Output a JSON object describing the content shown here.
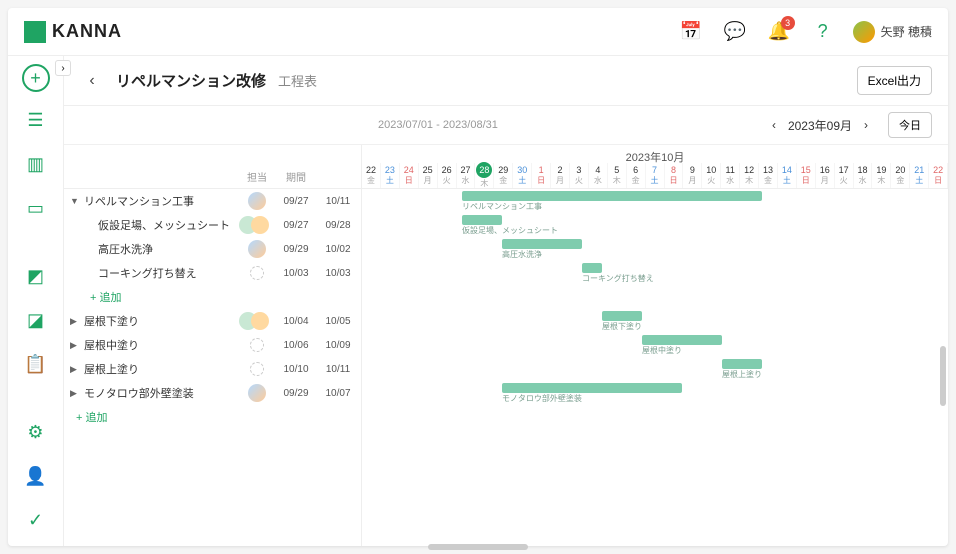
{
  "app": {
    "name": "KANNA"
  },
  "topbar": {
    "badge": "3",
    "user_name": "矢野 穂積"
  },
  "header": {
    "title": "リペルマンション改修",
    "subtitle": "工程表",
    "excel_btn": "Excel出力"
  },
  "subheader": {
    "date_range": "2023/07/01 - 2023/08/31",
    "month_label": "2023年09月",
    "today_btn": "今日"
  },
  "cols": {
    "assignee": "担当",
    "period": "期間"
  },
  "month_header": "2023年10月",
  "days": [
    {
      "n": "22",
      "w": "金"
    },
    {
      "n": "23",
      "w": "土",
      "cls": "sat"
    },
    {
      "n": "24",
      "w": "日",
      "cls": "sun"
    },
    {
      "n": "25",
      "w": "月"
    },
    {
      "n": "26",
      "w": "火"
    },
    {
      "n": "27",
      "w": "水"
    },
    {
      "n": "28",
      "w": "木",
      "cls": "today"
    },
    {
      "n": "29",
      "w": "金"
    },
    {
      "n": "30",
      "w": "土",
      "cls": "sat"
    },
    {
      "n": "1",
      "w": "日",
      "cls": "sun"
    },
    {
      "n": "2",
      "w": "月"
    },
    {
      "n": "3",
      "w": "火"
    },
    {
      "n": "4",
      "w": "水"
    },
    {
      "n": "5",
      "w": "木"
    },
    {
      "n": "6",
      "w": "金"
    },
    {
      "n": "7",
      "w": "土",
      "cls": "sat"
    },
    {
      "n": "8",
      "w": "日",
      "cls": "sun"
    },
    {
      "n": "9",
      "w": "月"
    },
    {
      "n": "10",
      "w": "火"
    },
    {
      "n": "11",
      "w": "水"
    },
    {
      "n": "12",
      "w": "木"
    },
    {
      "n": "13",
      "w": "金"
    },
    {
      "n": "14",
      "w": "土",
      "cls": "sat"
    },
    {
      "n": "15",
      "w": "日",
      "cls": "sun"
    },
    {
      "n": "16",
      "w": "月"
    },
    {
      "n": "17",
      "w": "火"
    },
    {
      "n": "18",
      "w": "水"
    },
    {
      "n": "19",
      "w": "木"
    },
    {
      "n": "20",
      "w": "金"
    },
    {
      "n": "21",
      "w": "土",
      "cls": "sat"
    },
    {
      "n": "22",
      "w": "日",
      "cls": "sun"
    }
  ],
  "tasks": [
    {
      "name": "リペルマンション工事",
      "level": 0,
      "expand": "▼",
      "ass": "single",
      "start": "09/27",
      "end": "10/11",
      "bar_start": 5,
      "bar_len": 15,
      "label": "リペルマンション工事"
    },
    {
      "name": "仮設足場、メッシュシート",
      "level": 1,
      "ass": "double",
      "start": "09/27",
      "end": "09/28",
      "bar_start": 5,
      "bar_len": 2,
      "label": "仮設足場、メッシュシート"
    },
    {
      "name": "高圧水洗浄",
      "level": 1,
      "ass": "single",
      "start": "09/29",
      "end": "10/02",
      "bar_start": 7,
      "bar_len": 4,
      "label": "高圧水洗浄"
    },
    {
      "name": "コーキング打ち替え",
      "level": 1,
      "ass": "empty",
      "start": "10/03",
      "end": "10/03",
      "bar_start": 11,
      "bar_len": 1,
      "label": "コーキング打ち替え"
    },
    {
      "name": "+ 追加",
      "level": 1,
      "add": true
    },
    {
      "name": "屋根下塗り",
      "level": 0,
      "expand": "▶",
      "ass": "double",
      "start": "10/04",
      "end": "10/05",
      "bar_start": 12,
      "bar_len": 2,
      "label": "屋根下塗り"
    },
    {
      "name": "屋根中塗り",
      "level": 0,
      "expand": "▶",
      "ass": "empty",
      "start": "10/06",
      "end": "10/09",
      "bar_start": 14,
      "bar_len": 4,
      "label": "屋根中塗り"
    },
    {
      "name": "屋根上塗り",
      "level": 0,
      "expand": "▶",
      "ass": "empty",
      "start": "10/10",
      "end": "10/11",
      "bar_start": 18,
      "bar_len": 2,
      "label": "屋根上塗り"
    },
    {
      "name": "モノタロウ部外壁塗装",
      "level": 0,
      "expand": "▶",
      "ass": "single",
      "start": "09/29",
      "end": "10/07",
      "bar_start": 7,
      "bar_len": 9,
      "label": "モノタロウ部外壁塗装"
    },
    {
      "name": "+ 追加",
      "level": 0,
      "add": true
    }
  ]
}
